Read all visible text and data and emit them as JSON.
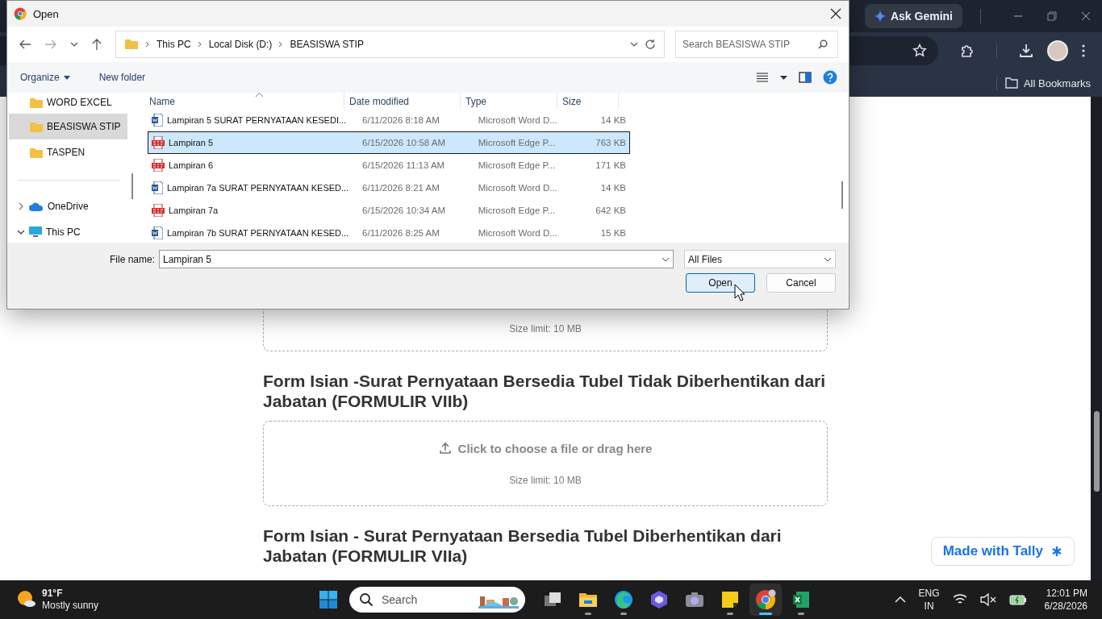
{
  "browser": {
    "ask_button": "Ask Gemini",
    "bookmarks": "All Bookmarks"
  },
  "page": {
    "sections": [
      {
        "hint": "Size limit: 10 MB"
      },
      {
        "title": "Form Isian -Surat Pernyataan Bersedia Tubel Tidak Diberhentikan dari Jabatan (FORMULIR VIIb)",
        "upload": "Click to choose a file or drag here",
        "hint": "Size limit: 10 MB"
      },
      {
        "title": "Form Isian - Surat Pernyataan Bersedia Tubel Diberhentikan dari Jabatan (FORMULIR VIIa)"
      }
    ],
    "badge": "Made with Tally"
  },
  "dialog": {
    "title": "Open",
    "breadcrumb": [
      "This PC",
      "Local Disk (D:)",
      "BEASISWA STIP"
    ],
    "search": {
      "placeholder": "Search BEASISWA STIP"
    },
    "toolbar": [
      "Organize",
      "New folder"
    ],
    "nav_tree": [
      {
        "label": "WORD EXCEL",
        "kind": "folder",
        "selected": false
      },
      {
        "label": "BEASISWA STIP",
        "kind": "folder",
        "selected": true
      },
      {
        "label": "TASPEN",
        "kind": "folder",
        "selected": false
      },
      {
        "label": "OneDrive",
        "kind": "cloud",
        "selected": false,
        "expanded": false
      },
      {
        "label": "This PC",
        "kind": "pc",
        "selected": false,
        "expanded": true
      }
    ],
    "columns": [
      "Name",
      "Date modified",
      "Type",
      "Size"
    ],
    "files": [
      {
        "name": "Lampiran 5 SURAT PERNYATAAN KESEDI...",
        "date": "6/11/2026 8:18 AM",
        "type": "Microsoft Word D...",
        "size": "14 KB",
        "kind": "word",
        "selected": false
      },
      {
        "name": "Lampiran 5",
        "date": "6/15/2026 10:58 AM",
        "type": "Microsoft Edge P...",
        "size": "763 KB",
        "kind": "pdf",
        "selected": true
      },
      {
        "name": "Lampiran 6",
        "date": "6/15/2026 11:13 AM",
        "type": "Microsoft Edge P...",
        "size": "171 KB",
        "kind": "pdf",
        "selected": false
      },
      {
        "name": "Lampiran 7a SURAT PERNYATAAN KESED...",
        "date": "6/11/2026 8:21 AM",
        "type": "Microsoft Word D...",
        "size": "14 KB",
        "kind": "word",
        "selected": false
      },
      {
        "name": "Lampiran 7a",
        "date": "6/15/2026 10:34 AM",
        "type": "Microsoft Edge P...",
        "size": "642 KB",
        "kind": "pdf",
        "selected": false
      },
      {
        "name": "Lampiran 7b SURAT PERNYATAAN KESED...",
        "date": "6/11/2026 8:25 AM",
        "type": "Microsoft Word D...",
        "size": "15 KB",
        "kind": "word",
        "selected": false
      }
    ],
    "file_name": {
      "label": "File name:",
      "value": "Lampiran 5"
    },
    "file_type": "All Files",
    "buttons": [
      "Open",
      "Cancel"
    ]
  },
  "taskbar": {
    "weather": {
      "temp": "91°F",
      "condition": "Mostly sunny"
    },
    "search": {
      "placeholder": "Search"
    },
    "apps": [
      {
        "kind": "task-view",
        "running": false,
        "selected": false
      },
      {
        "kind": "files",
        "running": true,
        "selected": false
      },
      {
        "kind": "edge",
        "running": true,
        "selected": false
      },
      {
        "kind": "copilot",
        "running": false,
        "selected": false
      },
      {
        "kind": "camera",
        "running": false,
        "selected": false
      },
      {
        "kind": "notes",
        "running": true,
        "selected": false
      },
      {
        "kind": "chrome",
        "running": true,
        "selected": true
      },
      {
        "kind": "excel",
        "running": true,
        "selected": false
      }
    ],
    "language": [
      "ENG",
      "IN"
    ],
    "time": "12:01 PM",
    "date": "6/28/2026"
  }
}
